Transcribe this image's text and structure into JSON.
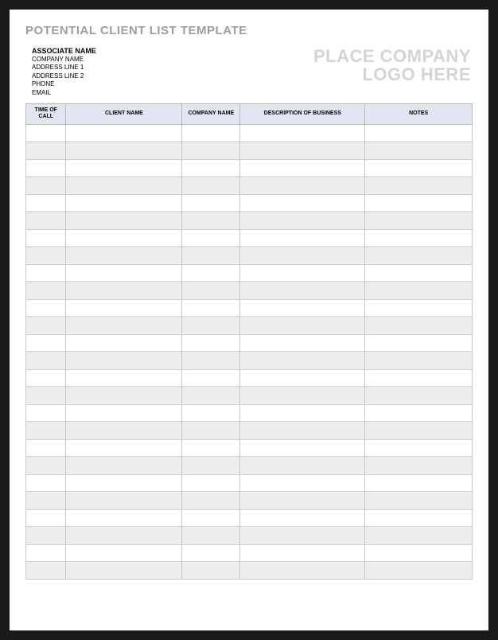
{
  "title": "POTENTIAL CLIENT LIST TEMPLATE",
  "associate": {
    "name_label": "ASSOCIATE NAME",
    "company": "COMPANY NAME",
    "address1": "ADDRESS LINE 1",
    "address2": "ADDRESS LINE 2",
    "phone": "PHONE",
    "email": "EMAIL"
  },
  "logo": {
    "line1": "PLACE COMPANY",
    "line2": "LOGO HERE"
  },
  "table": {
    "headers": {
      "time": "TIME OF CALL",
      "client": "CLIENT NAME",
      "company": "COMPANY NAME",
      "desc": "DESCRIPTION OF BUSINESS",
      "notes": "NOTES"
    },
    "row_count": 26
  }
}
